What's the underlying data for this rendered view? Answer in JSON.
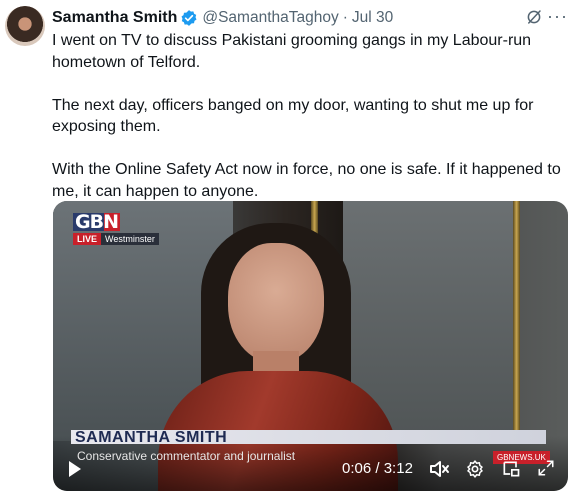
{
  "tweet": {
    "author_name": "Samantha Smith",
    "handle": "@SamanthaTaghoy",
    "separator": "·",
    "date": "Jul 30",
    "more": "···",
    "paragraphs": [
      "I went on TV to discuss Pakistani grooming gangs in my Labour-run hometown of Telford.",
      "The next day, officers banged on my door, wanting to shut me up for exposing them.",
      "With the Online Safety Act now in force, no one is safe. If it happened to me, it can happen to anyone."
    ]
  },
  "video": {
    "channel_logo": "GBN",
    "live_label": "LIVE",
    "location": "Westminster",
    "lower_third_name": "SAMANTHA SMITH",
    "lower_third_title": "Conservative commentator and journalist",
    "website": "GBNEWS.UK",
    "current_time": "0:06",
    "duration": "3:12",
    "time_separator": " / "
  },
  "icons": {
    "verified": "verified-badge-icon",
    "grok": "grok-icon",
    "more": "more-icon",
    "play": "play-icon",
    "mute": "mute-icon",
    "settings": "settings-icon",
    "pip": "picture-in-picture-icon",
    "fullscreen": "fullscreen-icon"
  },
  "colors": {
    "verified_blue": "#1d9bf0",
    "secondary_text": "#536471",
    "primary_text": "#0f1419",
    "gbn_red": "#c8202a",
    "gbn_navy": "#1e2a52"
  }
}
